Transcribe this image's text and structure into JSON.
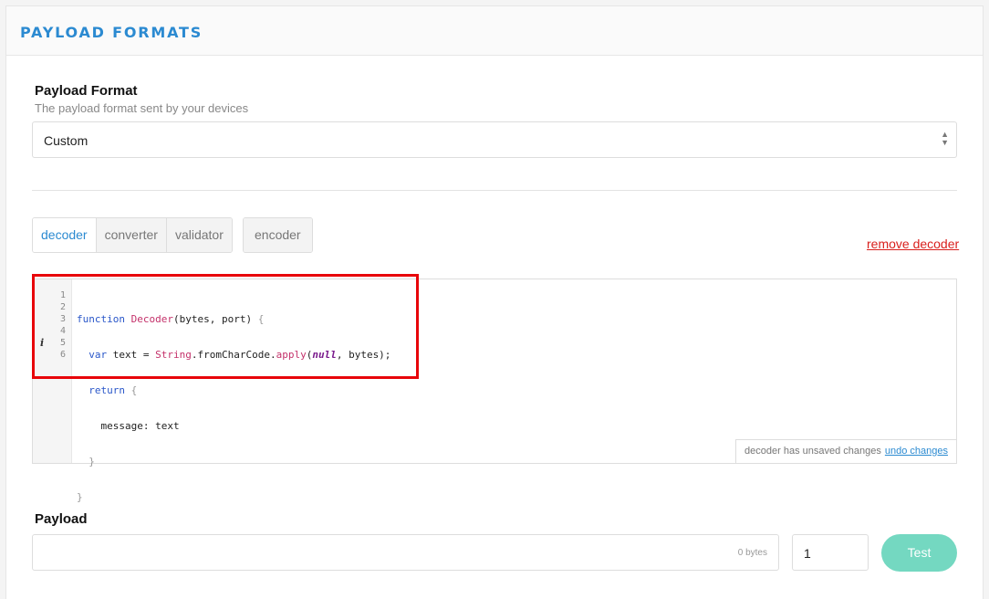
{
  "header": {
    "title": "PAYLOAD FORMATS"
  },
  "format": {
    "label": "Payload Format",
    "description": "The payload format sent by your devices",
    "selected": "Custom"
  },
  "tabs": {
    "group1": [
      "decoder",
      "converter",
      "validator"
    ],
    "group2": [
      "encoder"
    ],
    "active": "decoder"
  },
  "remove_link": "remove decoder",
  "editor": {
    "line_numbers": [
      "1",
      "2",
      "3",
      "4",
      "5",
      "6"
    ],
    "info_marker_line": "5",
    "code_lines": [
      "function Decoder(bytes, port) {",
      "  var text = String.fromCharCode.apply(null, bytes);",
      "  return {",
      "    message: text",
      "  }",
      "}"
    ],
    "unsaved_text": "decoder has unsaved changes",
    "undo_label": "undo changes"
  },
  "payload": {
    "label": "Payload",
    "bytes_text": "0 bytes",
    "port_value": "1",
    "test_label": "Test"
  },
  "colors": {
    "accent": "#2b8ad1",
    "danger": "#d9201d",
    "test_button": "#74d8c1",
    "highlight_box": "#e8050a"
  }
}
